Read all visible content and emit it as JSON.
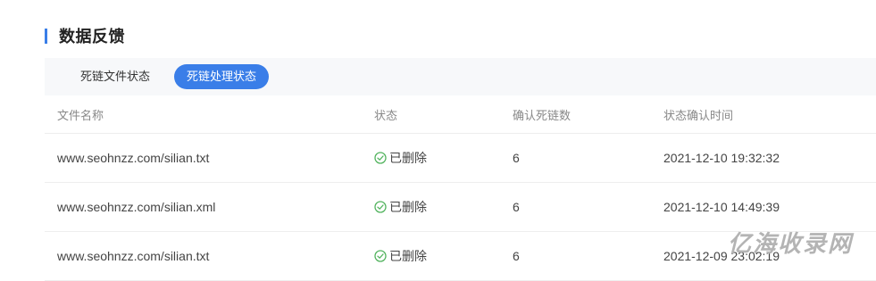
{
  "section": {
    "title": "数据反馈"
  },
  "tabs": [
    {
      "label": "死链文件状态",
      "active": false
    },
    {
      "label": "死链处理状态",
      "active": true
    }
  ],
  "table": {
    "headers": [
      "文件名称",
      "状态",
      "确认死链数",
      "状态确认时间"
    ],
    "rows": [
      {
        "file": "www.seohnzz.com/silian.txt",
        "status": "已删除",
        "count": "6",
        "time": "2021-12-10 19:32:32"
      },
      {
        "file": "www.seohnzz.com/silian.xml",
        "status": "已删除",
        "count": "6",
        "time": "2021-12-10 14:49:39"
      },
      {
        "file": "www.seohnzz.com/silian.txt",
        "status": "已删除",
        "count": "6",
        "time": "2021-12-09 23:02:19"
      }
    ]
  },
  "watermark": {
    "text": "亿海收录网"
  },
  "colors": {
    "accent": "#3a7ee8",
    "success": "#52b35e",
    "header_text": "#888888"
  },
  "icons": {
    "status": "check-circle-icon"
  }
}
